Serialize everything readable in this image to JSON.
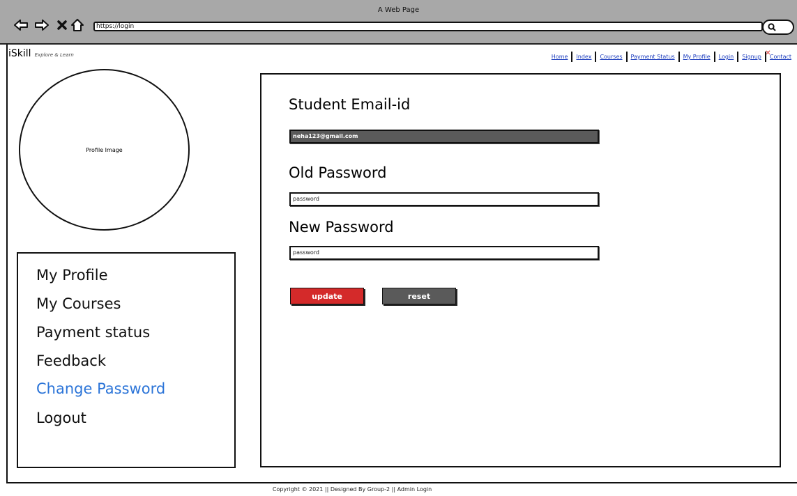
{
  "browser": {
    "window_title": "A Web Page",
    "url": "https://login"
  },
  "brand": {
    "name": "iSkill",
    "tagline": "Explore & Learn"
  },
  "top_nav": {
    "items": [
      "Home",
      "Index",
      "Courses",
      "Payment Status",
      "My Profile",
      "Login",
      "Signup",
      "Contact"
    ]
  },
  "profile": {
    "image_label": "Profile Image"
  },
  "side_menu": {
    "items": [
      "My Profile",
      "My Courses",
      "Payment status",
      "Feedback",
      "Change Password",
      "Logout"
    ],
    "active": "Change Password"
  },
  "form": {
    "email_label": "Student Email-id",
    "email_value": "neha123@gmail.com",
    "old_password_label": "Old Password",
    "old_password_value": "password",
    "new_password_label": "New Password",
    "new_password_value": "password",
    "update_label": "update",
    "reset_label": "reset"
  },
  "footer": {
    "text": "Copyright © 2021 || Designed By Group-2 || Admin Login"
  },
  "colors": {
    "chrome_bg": "#a8a8a8",
    "link": "#1a3bbd",
    "active_menu": "#2b74d8",
    "update_button": "#d42a2a",
    "reset_button": "#5a5a5a",
    "email_field_bg": "#5a5a5a"
  }
}
